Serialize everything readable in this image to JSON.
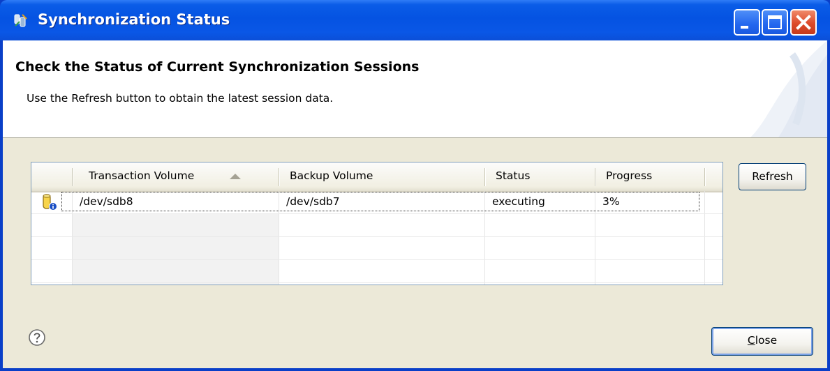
{
  "window": {
    "title": "Synchronization Status",
    "titlebar_color": "#0553e2"
  },
  "header": {
    "title": "Check the Status of Current Synchronization Sessions",
    "description": "Use the Refresh button to obtain the latest session data."
  },
  "table": {
    "columns": [
      "Transaction Volume",
      "Backup Volume",
      "Status",
      "Progress"
    ],
    "sorted_column": "Transaction Volume",
    "sort_direction": "ascending",
    "rows": [
      {
        "icon": "database-info-icon",
        "transaction_volume": "/dev/sdb8",
        "backup_volume": "/dev/sdb7",
        "status": "executing",
        "progress": "3%"
      }
    ]
  },
  "buttons": {
    "refresh": "Refresh",
    "close_mnemonic": "C",
    "close_rest": "lose"
  },
  "icons": {
    "app": "sync-app-icon",
    "help": "help-icon",
    "minimize": "minimize-icon",
    "maximize": "maximize-icon",
    "close": "close-icon"
  }
}
